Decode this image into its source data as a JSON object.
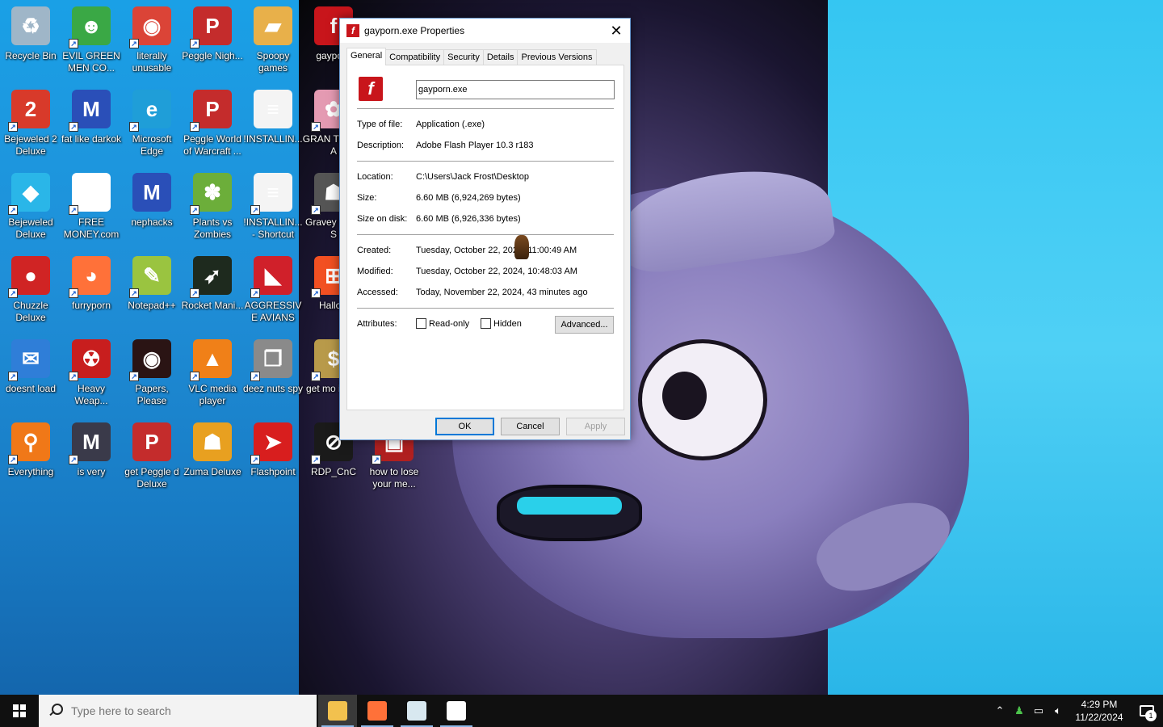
{
  "desktop": {
    "icons": [
      {
        "label": "Recycle Bin",
        "icon": "recycle-bin-icon",
        "color": "#9fb6c8",
        "glyph": "♻",
        "shortcut": false
      },
      {
        "label": "EVIL GREEN MEN CO...",
        "icon": "green-men-icon",
        "color": "#3aa845",
        "glyph": "☻",
        "shortcut": true
      },
      {
        "label": "literally unusable",
        "icon": "chrome-icon",
        "color": "#db4437",
        "glyph": "◉",
        "shortcut": true
      },
      {
        "label": "Peggle Nigh...",
        "icon": "peggle-icon",
        "color": "#c42c2c",
        "glyph": "P",
        "shortcut": true
      },
      {
        "label": "Spoopy games",
        "icon": "folder-icon",
        "color": "#e8b04a",
        "glyph": "▰",
        "shortcut": false
      },
      {
        "label": "gayporn",
        "icon": "flash-icon",
        "color": "#c8151b",
        "glyph": "f",
        "shortcut": false
      },
      {
        "label": "Bejeweled 2 Deluxe",
        "icon": "bejeweled2-icon",
        "color": "#d83a2a",
        "glyph": "2",
        "shortcut": true
      },
      {
        "label": "fat like darkok",
        "icon": "mpi-icon",
        "color": "#2a4fb8",
        "glyph": "M",
        "shortcut": true
      },
      {
        "label": "Microsoft Edge",
        "icon": "edge-icon",
        "color": "#1f9ed8",
        "glyph": "e",
        "shortcut": true
      },
      {
        "label": "Peggle World of Warcraft ...",
        "icon": "peggle-icon",
        "color": "#c42c2c",
        "glyph": "P",
        "shortcut": true
      },
      {
        "label": "!INSTALLIN...",
        "icon": "text-file-icon",
        "color": "#f4f4f4",
        "glyph": "≡",
        "shortcut": false
      },
      {
        "label": "GRAN THEFT A",
        "icon": "anime-icon",
        "color": "#e49ab2",
        "glyph": "✿",
        "shortcut": true
      },
      {
        "label": "Bejeweled Deluxe",
        "icon": "diamond-icon",
        "color": "#2ab6e8",
        "glyph": "◆",
        "shortcut": true
      },
      {
        "label": "FREE MONEY.com",
        "icon": "blank-file-icon",
        "color": "#ffffff",
        "glyph": "",
        "shortcut": true
      },
      {
        "label": "nephacks",
        "icon": "mpi-icon",
        "color": "#2a4fb8",
        "glyph": "M",
        "shortcut": false
      },
      {
        "label": "Plants vs Zombies",
        "icon": "pvz-icon",
        "color": "#6cae3a",
        "glyph": "✽",
        "shortcut": true
      },
      {
        "label": "!INSTALLIN... - Shortcut",
        "icon": "text-file-icon",
        "color": "#f4f4f4",
        "glyph": "≡",
        "shortcut": true
      },
      {
        "label": "Gravey Party S",
        "icon": "gravey-icon",
        "color": "#555",
        "glyph": "☗",
        "shortcut": true
      },
      {
        "label": "Chuzzle Deluxe",
        "icon": "chuzzle-icon",
        "color": "#d02424",
        "glyph": "●",
        "shortcut": true
      },
      {
        "label": "furryporn",
        "icon": "firefox-icon",
        "color": "#ff7139",
        "glyph": "◕",
        "shortcut": true
      },
      {
        "label": "Notepad++",
        "icon": "notepadpp-icon",
        "color": "#9ac440",
        "glyph": "✎",
        "shortcut": true
      },
      {
        "label": "Rocket Mani...",
        "icon": "rocket-icon",
        "color": "#1e2a1e",
        "glyph": "➶",
        "shortcut": true
      },
      {
        "label": "AGGRESSIVE AVIANS",
        "icon": "angry-bird-icon",
        "color": "#d0202a",
        "glyph": "◣",
        "shortcut": true
      },
      {
        "label": "HalloD",
        "icon": "windows-icon",
        "color": "#f25022",
        "glyph": "⊞",
        "shortcut": true
      },
      {
        "label": "doesnt load",
        "icon": "thunderbird-icon",
        "color": "#2f7ed8",
        "glyph": "✉",
        "shortcut": true
      },
      {
        "label": "Heavy Weap...",
        "icon": "radiation-icon",
        "color": "#c81e1e",
        "glyph": "☢",
        "shortcut": true
      },
      {
        "label": "Papers, Please",
        "icon": "papers-icon",
        "color": "#2a1414",
        "glyph": "◉",
        "shortcut": true
      },
      {
        "label": "VLC media player",
        "icon": "vlc-icon",
        "color": "#f08018",
        "glyph": "▲",
        "shortcut": true
      },
      {
        "label": "deez nuts spy",
        "icon": "windows-stack-icon",
        "color": "#8a8a8a",
        "glyph": "❐",
        "shortcut": true
      },
      {
        "label": "get mo illega",
        "icon": "money-bag-icon",
        "color": "#b89a4a",
        "glyph": "$",
        "shortcut": true
      },
      {
        "label": "Everything",
        "icon": "magnifier-icon",
        "color": "#f07818",
        "glyph": "⚲",
        "shortcut": true
      },
      {
        "label": "is very",
        "icon": "shield-mpi-icon",
        "color": "#3a3a4a",
        "glyph": "M",
        "shortcut": true
      },
      {
        "label": "get Peggle d Deluxe",
        "icon": "peggle-icon",
        "color": "#c42c2c",
        "glyph": "P",
        "shortcut": false
      },
      {
        "label": "Zuma Deluxe",
        "icon": "zuma-icon",
        "color": "#e8a020",
        "glyph": "☗",
        "shortcut": false
      },
      {
        "label": "Flashpoint",
        "icon": "flashpoint-icon",
        "color": "#d81e1e",
        "glyph": "➤",
        "shortcut": true
      },
      {
        "label": "RDP_CnC",
        "icon": "rdp-icon",
        "color": "#1a1a1a",
        "glyph": "⊘",
        "shortcut": true
      },
      {
        "label": "how to lose your me...",
        "icon": "video-thumb-icon",
        "color": "#b02020",
        "glyph": "▣",
        "shortcut": true
      }
    ]
  },
  "dialog": {
    "title": "gayporn.exe Properties",
    "close_label": "✕",
    "tabs": [
      "General",
      "Compatibility",
      "Security",
      "Details",
      "Previous Versions"
    ],
    "active_tab": 0,
    "file_name": "gayporn.exe",
    "type_label": "Type of file:",
    "type_value": "Application (.exe)",
    "description_label": "Description:",
    "description_value": "Adobe Flash Player 10.3 r183",
    "location_label": "Location:",
    "location_value": "C:\\Users\\Jack Frost\\Desktop",
    "size_label": "Size:",
    "size_value": "6.60 MB (6,924,269 bytes)",
    "size_on_disk_label": "Size on disk:",
    "size_on_disk_value": "6.60 MB (6,926,336 bytes)",
    "created_label": "Created:",
    "created_value": "Tuesday, October 22, 2024, 11:00:49 AM",
    "modified_label": "Modified:",
    "modified_value": "Tuesday, October 22, 2024, 10:48:03 AM",
    "accessed_label": "Accessed:",
    "accessed_value": "Today, November 22, 2024, 43 minutes ago",
    "attributes_label": "Attributes:",
    "readonly_label": "Read-only",
    "hidden_label": "Hidden",
    "advanced_label": "Advanced...",
    "ok_label": "OK",
    "cancel_label": "Cancel",
    "apply_label": "Apply"
  },
  "taskbar": {
    "search_placeholder": "Type here to search",
    "apps": [
      {
        "name": "file-explorer-icon",
        "color": "#f2c14e",
        "open": true,
        "active": true
      },
      {
        "name": "firefox-icon",
        "color": "#ff7139",
        "open": true,
        "active": false
      },
      {
        "name": "window-app-icon",
        "color": "#d8e8f0",
        "open": true,
        "active": false
      },
      {
        "name": "7zip-icon",
        "color": "#ffffff",
        "open": true,
        "active": false
      }
    ],
    "clock_time": "4:29 PM",
    "clock_date": "11/22/2024",
    "notification_count": "1",
    "accent": "#0078d7"
  }
}
